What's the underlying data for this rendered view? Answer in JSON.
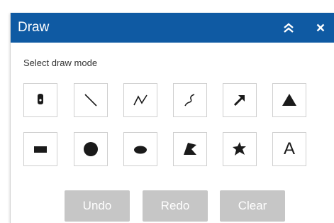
{
  "panel": {
    "title": "Draw",
    "collapse_icon": "double-chevron-up-icon",
    "close_label": "×",
    "header_color": "#0f5aa3"
  },
  "prompt": "Select draw mode",
  "tools_row1": [
    {
      "name": "point",
      "icon": "point-icon"
    },
    {
      "name": "line",
      "icon": "line-icon"
    },
    {
      "name": "polyline",
      "icon": "polyline-icon"
    },
    {
      "name": "freehand-polyline",
      "icon": "freehand-polyline-icon"
    },
    {
      "name": "arrow",
      "icon": "arrow-icon"
    },
    {
      "name": "triangle",
      "icon": "triangle-icon"
    }
  ],
  "tools_row2": [
    {
      "name": "rectangle",
      "icon": "rectangle-icon"
    },
    {
      "name": "circle",
      "icon": "circle-icon"
    },
    {
      "name": "ellipse",
      "icon": "ellipse-icon"
    },
    {
      "name": "polygon",
      "icon": "polygon-icon"
    },
    {
      "name": "freehand-polygon",
      "icon": "freehand-polygon-icon"
    },
    {
      "name": "text",
      "icon": "text-icon",
      "label": "A"
    }
  ],
  "actions": {
    "undo": "Undo",
    "redo": "Redo",
    "clear": "Clear",
    "disabled_color": "#c6c6c6"
  }
}
